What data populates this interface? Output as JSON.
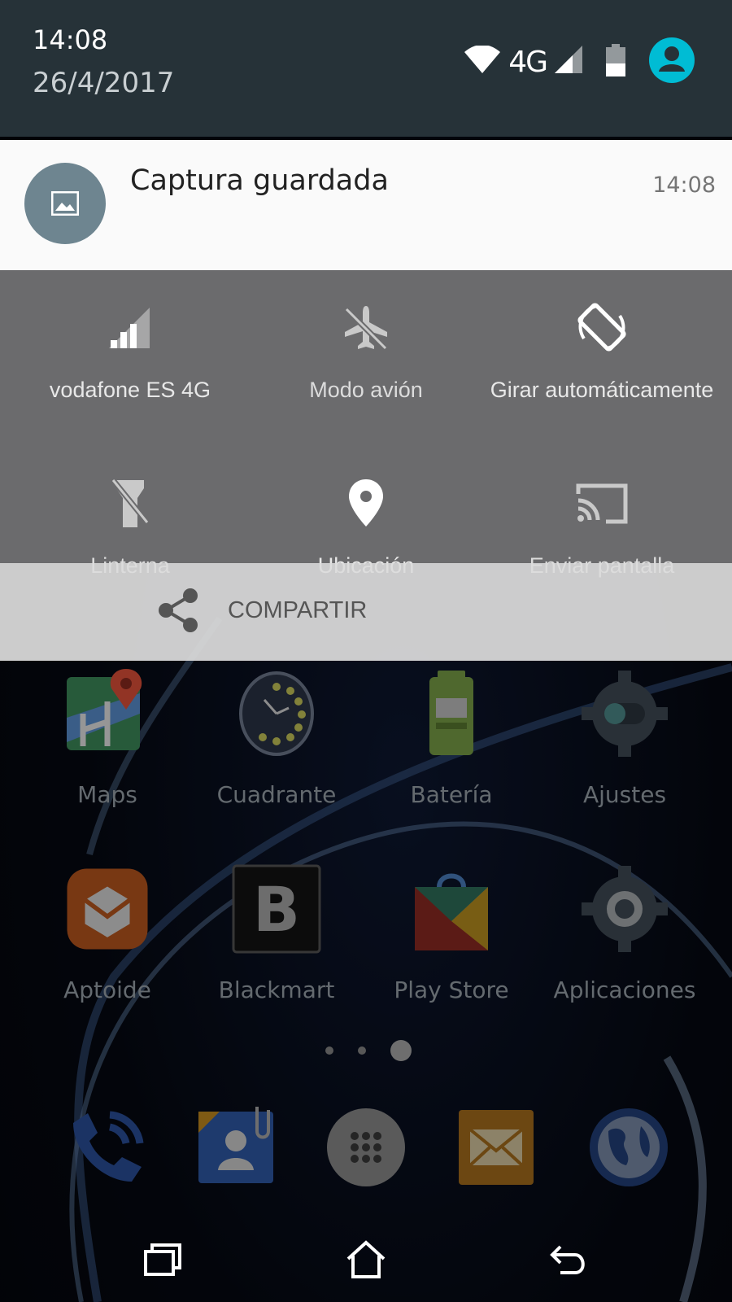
{
  "status_bar": {
    "time": "14:08",
    "date": "26/4/2017",
    "network": "4G"
  },
  "notification": {
    "title": "Captura guardada",
    "time": "14:08",
    "icon": "image-icon"
  },
  "quick_settings": {
    "tiles": [
      {
        "label": "vodafone ES 4G",
        "icon": "signal-icon"
      },
      {
        "label": "Modo avión",
        "icon": "airplane-icon"
      },
      {
        "label": "Girar automáticamente",
        "icon": "rotate-icon"
      },
      {
        "label": "Linterna",
        "icon": "flashlight-icon"
      },
      {
        "label": "Ubicación",
        "icon": "location-icon"
      },
      {
        "label": "Enviar pantalla",
        "icon": "cast-icon"
      }
    ]
  },
  "share": {
    "label": "COMPARTIR",
    "icon": "share-icon"
  },
  "home": {
    "apps": [
      {
        "label": "Maps"
      },
      {
        "label": "Cuadrante"
      },
      {
        "label": "Batería"
      },
      {
        "label": "Ajustes"
      },
      {
        "label": "Aptoide"
      },
      {
        "label": "Blackmart"
      },
      {
        "label": "Play Store"
      },
      {
        "label": "Aplicaciones"
      }
    ],
    "page_indicator": {
      "pages": 3,
      "current": 3
    }
  },
  "colors": {
    "status_bar": "#263238",
    "quick_settings": "#6b6b6d",
    "notification_bg": "#fafafa",
    "avatar": "#00bcd4"
  }
}
